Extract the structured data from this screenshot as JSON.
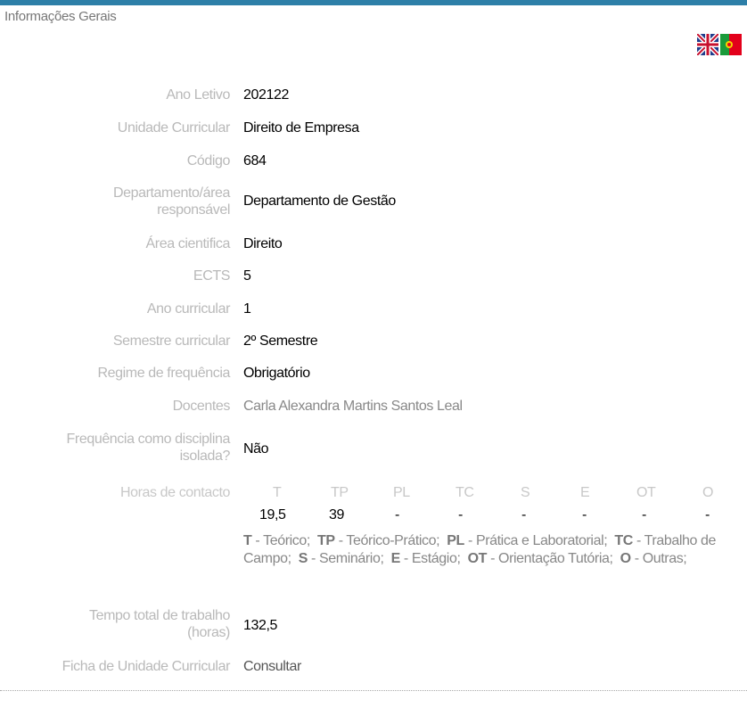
{
  "section": {
    "title": "Informações Gerais"
  },
  "flags": {
    "english": "uk-flag-icon",
    "portuguese": "portugal-flag-icon"
  },
  "fields": {
    "ano_letivo": {
      "label": "Ano Letivo",
      "value": "202122"
    },
    "unidade_curricular": {
      "label": "Unidade Curricular",
      "value": "Direito de Empresa"
    },
    "codigo": {
      "label": "Código",
      "value": "684"
    },
    "departamento": {
      "label1": "Departamento/área",
      "label2": "responsável",
      "value": "Departamento de Gestão"
    },
    "area_cientifica": {
      "label": "Área cientifica",
      "value": "Direito"
    },
    "ects": {
      "label": "ECTS",
      "value": "5"
    },
    "ano_curricular": {
      "label": "Ano curricular",
      "value": "1"
    },
    "semestre": {
      "label": "Semestre curricular",
      "value": "2º Semestre"
    },
    "regime": {
      "label": "Regime de frequência",
      "value": "Obrigatório"
    },
    "docentes": {
      "label": "Docentes",
      "value": "Carla Alexandra Martins Santos Leal"
    },
    "frequencia_isolada": {
      "label1": "Frequência como disciplina",
      "label2": "isolada?",
      "value": "Não"
    },
    "horas_contacto": {
      "label": "Horas de contacto",
      "columns": [
        {
          "head": "T",
          "value": "19,5"
        },
        {
          "head": "TP",
          "value": "39"
        },
        {
          "head": "PL",
          "value": "-"
        },
        {
          "head": "TC",
          "value": "-"
        },
        {
          "head": "S",
          "value": "-"
        },
        {
          "head": "E",
          "value": "-"
        },
        {
          "head": "OT",
          "value": "-"
        },
        {
          "head": "O",
          "value": "-"
        }
      ],
      "legend": [
        {
          "abbr": "T",
          "desc": " - Teórico;"
        },
        {
          "abbr": "TP",
          "desc": " - Teórico-Prático;"
        },
        {
          "abbr": "PL",
          "desc": " - Prática e Laboratorial;"
        },
        {
          "abbr": "TC",
          "desc": " - Trabalho de Campo;"
        },
        {
          "abbr": "S",
          "desc": " - Seminário;"
        },
        {
          "abbr": "E",
          "desc": " - Estágio;"
        },
        {
          "abbr": "OT",
          "desc": " - Orientação Tutória;"
        },
        {
          "abbr": "O",
          "desc": " - Outras;"
        }
      ]
    },
    "tempo_total": {
      "label1": "Tempo total de trabalho",
      "label2": "(horas)",
      "value": "132,5"
    },
    "ficha": {
      "label": "Ficha de Unidade Curricular",
      "value": "Consultar"
    }
  }
}
